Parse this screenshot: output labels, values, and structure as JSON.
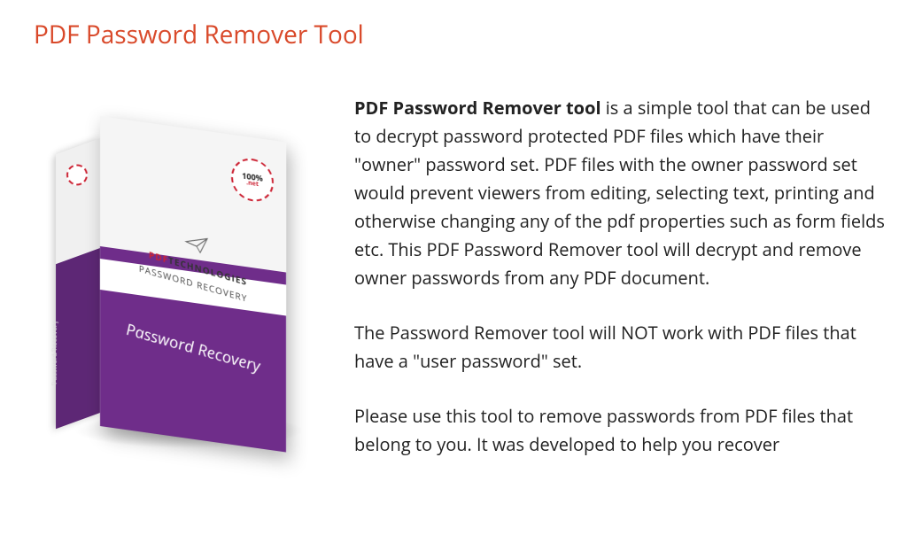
{
  "title": "PDF Password Remover Tool",
  "product_box": {
    "badge_text": "100%",
    "badge_sub": ".net",
    "brand_prefix": "PDF",
    "brand_suffix": "TECHNOLOGIES",
    "band_text": "PASSWORD RECOVERY",
    "main_label": "Password Recovery",
    "side_bottom": "Password Recovery"
  },
  "description": {
    "para1_bold": "PDF Password Remover tool",
    "para1_rest": " is a simple tool that can be used to decrypt password protected PDF files which have their \"owner\" password set. PDF files with the owner password set would prevent viewers from editing, selecting text, printing and otherwise changing any of the pdf properties such as form fields etc. This PDF Password Remover tool will decrypt and remove owner passwords from any PDF document.",
    "para2": "The Password Remover tool will NOT work with PDF files that have a \"user password\" set.",
    "para3": "Please use this tool to remove passwords from PDF files that belong to you. It was developed to help you recover"
  }
}
